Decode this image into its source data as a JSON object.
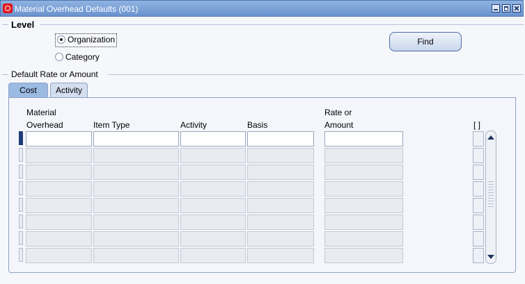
{
  "window": {
    "title": "Material Overhead Defaults (001)",
    "logo_icon": "oracle-logo-icon"
  },
  "level": {
    "title": "Level",
    "options": [
      {
        "label": "Organization",
        "selected": true
      },
      {
        "label": "Category",
        "selected": false
      }
    ],
    "find_label": "Find"
  },
  "rate_section": {
    "title": "Default Rate or Amount"
  },
  "tabs": [
    {
      "label": "Cost",
      "active": true
    },
    {
      "label": "Activity",
      "active": false
    }
  ],
  "grid": {
    "headers": {
      "material_overhead_1": "Material",
      "material_overhead_2": "Overhead",
      "item_type": "Item Type",
      "activity": "Activity",
      "basis": "Basis",
      "rate_1": "Rate or",
      "rate_2": "Amount",
      "flag": "[ ]"
    },
    "row_count": 8,
    "current_row": 1,
    "rows": [
      {
        "material_overhead": "",
        "item_type": "",
        "activity": "",
        "basis": "",
        "rate_or_amount": ""
      },
      {
        "material_overhead": "",
        "item_type": "",
        "activity": "",
        "basis": "",
        "rate_or_amount": ""
      },
      {
        "material_overhead": "",
        "item_type": "",
        "activity": "",
        "basis": "",
        "rate_or_amount": ""
      },
      {
        "material_overhead": "",
        "item_type": "",
        "activity": "",
        "basis": "",
        "rate_or_amount": ""
      },
      {
        "material_overhead": "",
        "item_type": "",
        "activity": "",
        "basis": "",
        "rate_or_amount": ""
      },
      {
        "material_overhead": "",
        "item_type": "",
        "activity": "",
        "basis": "",
        "rate_or_amount": ""
      },
      {
        "material_overhead": "",
        "item_type": "",
        "activity": "",
        "basis": "",
        "rate_or_amount": ""
      },
      {
        "material_overhead": "",
        "item_type": "",
        "activity": "",
        "basis": "",
        "rate_or_amount": ""
      }
    ]
  },
  "colors": {
    "title_bar": "#6b93cf",
    "active_tab": "#9cbbe3",
    "current_row_indicator": "#1e3c78"
  }
}
